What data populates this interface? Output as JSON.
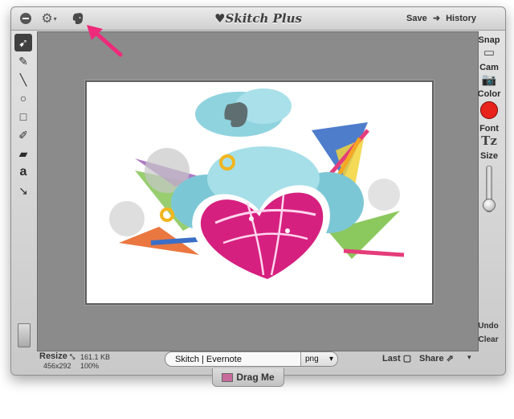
{
  "titlebar": {
    "app_title": "♥Skitch Plus",
    "save_label": "Save",
    "history_label": "History"
  },
  "tools": [
    {
      "name": "select-tool",
      "icon": "pointer-icon",
      "glyph": "⇱",
      "active": true
    },
    {
      "name": "pen-tool",
      "icon": "pen-icon",
      "glyph": "✎"
    },
    {
      "name": "line-tool",
      "icon": "line-icon",
      "glyph": "╲"
    },
    {
      "name": "ellipse-tool",
      "icon": "ellipse-icon",
      "glyph": "○"
    },
    {
      "name": "rectangle-tool",
      "icon": "rectangle-icon",
      "glyph": "□"
    },
    {
      "name": "highlighter-tool",
      "icon": "highlighter-icon",
      "glyph": "✐"
    },
    {
      "name": "eraser-tool",
      "icon": "eraser-icon",
      "glyph": "▰"
    },
    {
      "name": "text-tool",
      "icon": "text-icon",
      "glyph": "a"
    },
    {
      "name": "arrow-tool",
      "icon": "arrow-icon",
      "glyph": "↘"
    }
  ],
  "right_panel": {
    "snap_label": "Snap",
    "cam_label": "Cam",
    "color_label": "Color",
    "font_label": "Font",
    "font_glyph": "Tz",
    "size_label": "Size",
    "current_color": "#e8231b",
    "size_level": 0.05,
    "undo_label": "Undo",
    "clear_label": "Clear"
  },
  "bottom": {
    "resize_label": "Resize",
    "dimensions": "456x292",
    "file_size": "161.1 KB",
    "zoom": "100%",
    "filename": "Skitch | Evernote",
    "format": "png",
    "last_label": "Last",
    "share_label": "Share",
    "drag_label": "Drag Me"
  },
  "colors": {
    "canvas_bg": "#8b8b8b",
    "annotation_arrow": "#ee2a7b"
  }
}
